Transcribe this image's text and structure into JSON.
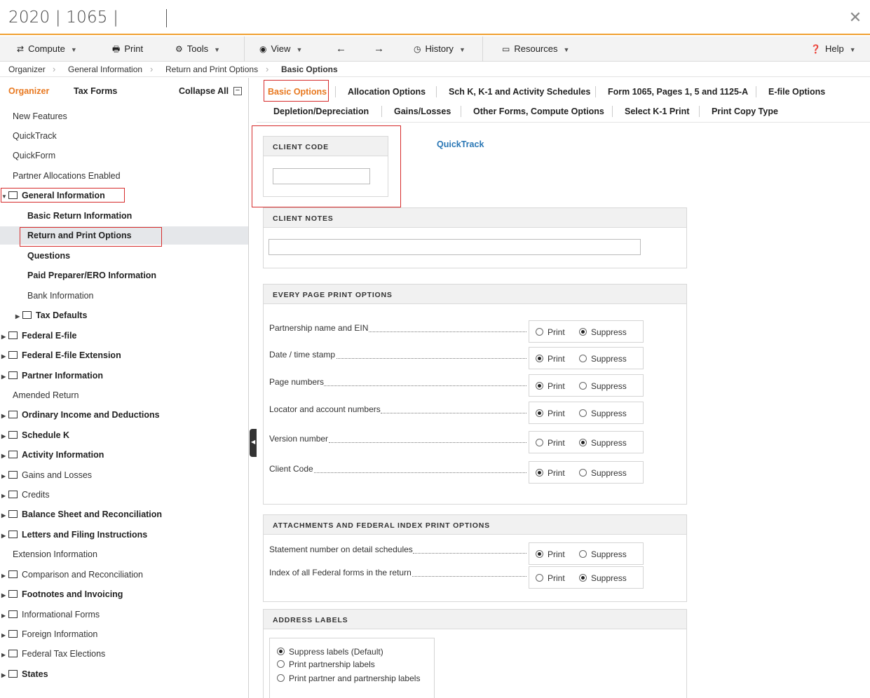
{
  "window": {
    "title": "2020 | 1065 |"
  },
  "toolbar": {
    "compute": "Compute",
    "print": "Print",
    "tools": "Tools",
    "view": "View",
    "history": "History",
    "resources": "Resources",
    "help": "Help"
  },
  "breadcrumb": [
    "Organizer",
    "General Information",
    "Return and Print Options",
    "Basic Options"
  ],
  "sidebar": {
    "organizer_tab": "Organizer",
    "taxforms_tab": "Tax Forms",
    "collapse_all": "Collapse All",
    "items": [
      {
        "label": "New Features"
      },
      {
        "label": "QuickTrack"
      },
      {
        "label": "QuickForm"
      },
      {
        "label": "Partner Allocations Enabled"
      },
      {
        "label": "General Information"
      },
      {
        "label": "Basic Return Information"
      },
      {
        "label": "Return and Print Options"
      },
      {
        "label": "Questions"
      },
      {
        "label": "Paid Preparer/ERO Information"
      },
      {
        "label": "Bank Information"
      },
      {
        "label": "Tax Defaults"
      },
      {
        "label": "Federal E-file"
      },
      {
        "label": "Federal E-file Extension"
      },
      {
        "label": "Partner Information"
      },
      {
        "label": "Amended Return"
      },
      {
        "label": "Ordinary Income and Deductions"
      },
      {
        "label": "Schedule K"
      },
      {
        "label": "Activity Information"
      },
      {
        "label": "Gains and Losses"
      },
      {
        "label": "Credits"
      },
      {
        "label": "Balance Sheet and Reconciliation"
      },
      {
        "label": "Letters and Filing Instructions"
      },
      {
        "label": "Extension Information"
      },
      {
        "label": "Comparison and Reconciliation"
      },
      {
        "label": "Footnotes and Invoicing"
      },
      {
        "label": "Informational Forms"
      },
      {
        "label": "Foreign Information"
      },
      {
        "label": "Federal Tax Elections"
      },
      {
        "label": "States"
      }
    ]
  },
  "tabs": {
    "row1": [
      "Basic Options",
      "Allocation Options",
      "Sch K, K-1 and Activity Schedules",
      "Form 1065, Pages 1, 5 and 1125-A",
      "E-file Options"
    ],
    "row2": [
      "Depletion/Depreciation",
      "Gains/Losses",
      "Other Forms, Compute Options",
      "Select K-1 Print",
      "Print Copy Type"
    ]
  },
  "client_code": {
    "header": "CLIENT CODE",
    "value": ""
  },
  "quicktrack_link": "QuickTrack",
  "client_notes": {
    "header": "CLIENT NOTES",
    "value": ""
  },
  "radio_labels": {
    "print": "Print",
    "suppress": "Suppress"
  },
  "every_page": {
    "header": "EVERY PAGE PRINT OPTIONS",
    "options": [
      {
        "label": "Partnership name and EIN",
        "selected": "Suppress"
      },
      {
        "label": "Date / time stamp",
        "selected": "Print"
      },
      {
        "label": "Page numbers",
        "selected": "Print"
      },
      {
        "label": "Locator and account numbers",
        "selected": "Print"
      },
      {
        "label": "Version number",
        "selected": "Suppress"
      },
      {
        "label": "Client Code",
        "selected": "Print"
      }
    ]
  },
  "attachments": {
    "header": "ATTACHMENTS AND FEDERAL INDEX PRINT OPTIONS",
    "options": [
      {
        "label": "Statement number on detail schedules",
        "selected": "Print"
      },
      {
        "label": "Index of all Federal forms in the return",
        "selected": "Suppress"
      }
    ]
  },
  "address_labels": {
    "header": "ADDRESS LABELS",
    "options": [
      "Suppress labels (Default)",
      "Print partnership labels",
      "Print partner and partnership labels"
    ],
    "selected": "Suppress labels (Default)"
  },
  "colors": {
    "accent": "#e8781f",
    "link": "#2a77b5",
    "highlight_box": "#d62b2b"
  }
}
